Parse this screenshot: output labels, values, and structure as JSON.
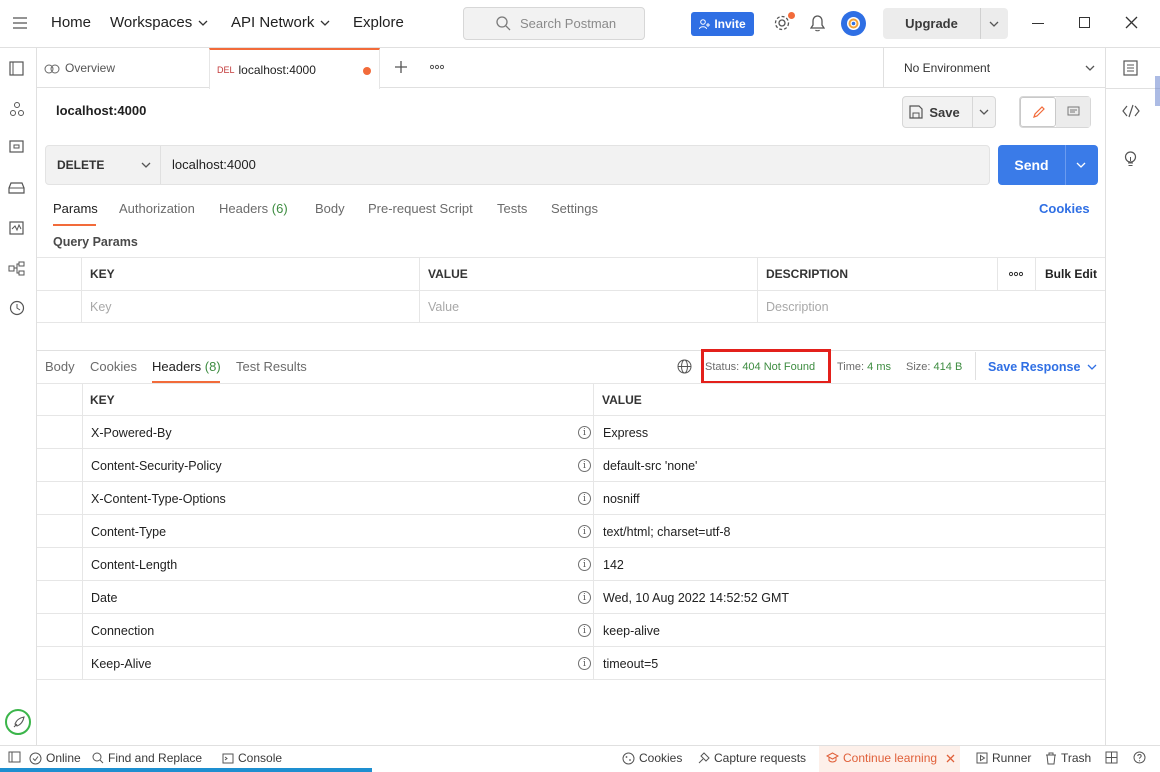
{
  "topbar": {
    "home": "Home",
    "workspaces": "Workspaces",
    "api_network": "API Network",
    "explore": "Explore",
    "search_placeholder": "Search Postman",
    "invite": "Invite",
    "upgrade": "Upgrade"
  },
  "tabs": {
    "overview": "Overview",
    "active_method": "DEL",
    "active_label": "localhost:4000",
    "environment": "No Environment"
  },
  "request": {
    "title": "localhost:4000",
    "save": "Save",
    "method": "DELETE",
    "url": "localhost:4000",
    "send": "Send",
    "tabs": [
      "Params",
      "Authorization",
      "Headers",
      "Body",
      "Pre-request Script",
      "Tests",
      "Settings"
    ],
    "headers_count": "(6)",
    "cookies": "Cookies",
    "query_params_title": "Query Params",
    "table_headers": [
      "KEY",
      "VALUE",
      "DESCRIPTION"
    ],
    "bulk_edit": "Bulk Edit",
    "placeholders": [
      "Key",
      "Value",
      "Description"
    ]
  },
  "response": {
    "tabs": [
      "Body",
      "Cookies",
      "Headers",
      "Test Results"
    ],
    "headers_count": "(8)",
    "status_label": "Status:",
    "status_value": "404 Not Found",
    "time_label": "Time:",
    "time_value": "4 ms",
    "size_label": "Size:",
    "size_value": "414 B",
    "save_response": "Save Response",
    "columns": [
      "KEY",
      "VALUE"
    ],
    "headers": [
      {
        "key": "X-Powered-By",
        "value": "Express"
      },
      {
        "key": "Content-Security-Policy",
        "value": "default-src 'none'"
      },
      {
        "key": "X-Content-Type-Options",
        "value": "nosniff"
      },
      {
        "key": "Content-Type",
        "value": "text/html; charset=utf-8"
      },
      {
        "key": "Content-Length",
        "value": "142"
      },
      {
        "key": "Date",
        "value": "Wed, 10 Aug 2022 14:52:52 GMT"
      },
      {
        "key": "Connection",
        "value": "keep-alive"
      },
      {
        "key": "Keep-Alive",
        "value": "timeout=5"
      }
    ]
  },
  "statusbar": {
    "online": "Online",
    "find_replace": "Find and Replace",
    "console": "Console",
    "cookies": "Cookies",
    "capture": "Capture requests",
    "continue_learning": "Continue learning",
    "runner": "Runner",
    "trash": "Trash"
  },
  "colors": {
    "accent_orange": "#f26b3a",
    "primary_blue": "#2f6fe4",
    "send_blue": "#3a7be8",
    "success_green": "#3d8c40",
    "highlight_red": "#e3201b"
  }
}
